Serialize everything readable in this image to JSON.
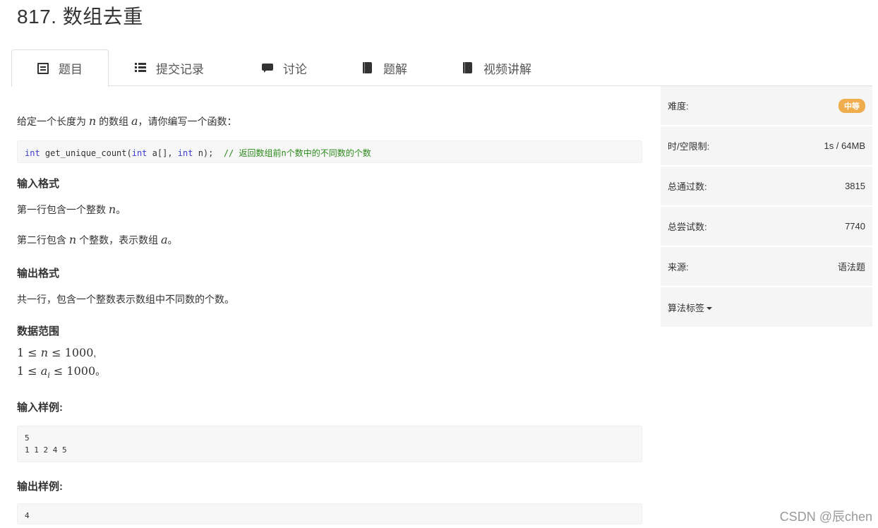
{
  "page": {
    "title": "817. 数组去重"
  },
  "tabs": [
    {
      "label": "题目",
      "icon": "document-icon",
      "active": true
    },
    {
      "label": "提交记录",
      "icon": "list-icon"
    },
    {
      "label": "讨论",
      "icon": "chat-icon"
    },
    {
      "label": "题解",
      "icon": "book-icon"
    },
    {
      "label": "视频讲解",
      "icon": "book-icon"
    }
  ],
  "problem": {
    "intro_pre": "给定一个长度为 ",
    "intro_var_n": "n",
    "intro_mid": " 的数组 ",
    "intro_var_a": "a",
    "intro_post": "，请你编写一个函数：",
    "code": {
      "kw1": "int",
      "fn": " get_unique_count(",
      "kw2": "int",
      "mid": " a[], ",
      "kw3": "int",
      "end": " n);  ",
      "comment": "// 返回数组前n个数中的不同数的个数"
    },
    "input_format_title": "输入格式",
    "input_line1_pre": "第一行包含一个整数 ",
    "input_line1_var": "n",
    "input_line1_post": "。",
    "input_line2_pre": "第二行包含 ",
    "input_line2_var": "n",
    "input_line2_mid": " 个整数，表示数组 ",
    "input_line2_var2": "a",
    "input_line2_post": "。",
    "output_format_title": "输出格式",
    "output_text": "共一行，包含一个整数表示数组中不同数的个数。",
    "range_title": "数据范围",
    "range1_a": "1 ≤ ",
    "range1_var": "n",
    "range1_b": " ≤ 1000",
    "range1_end": ",",
    "range2_a": "1 ≤ ",
    "range2_var": "a",
    "range2_sub": "i",
    "range2_b": " ≤ 1000",
    "range2_end": "。",
    "input_sample_title": "输入样例:",
    "input_sample": "5\n1 1 2 4 5",
    "output_sample_title": "输出样例:",
    "output_sample": "4"
  },
  "info": {
    "difficulty_label": "难度:",
    "difficulty_value": "中等",
    "limit_label": "时/空限制:",
    "limit_value": "1s / 64MB",
    "passed_label": "总通过数:",
    "passed_value": "3815",
    "tried_label": "总尝试数:",
    "tried_value": "7740",
    "source_label": "来源:",
    "source_value": "语法题",
    "tags_label": "算法标签"
  },
  "watermark": "CSDN @辰chen",
  "colors": {
    "badge": "#f0ad4e",
    "keyword": "#3b3bd6",
    "comment": "#2a8a1a"
  }
}
